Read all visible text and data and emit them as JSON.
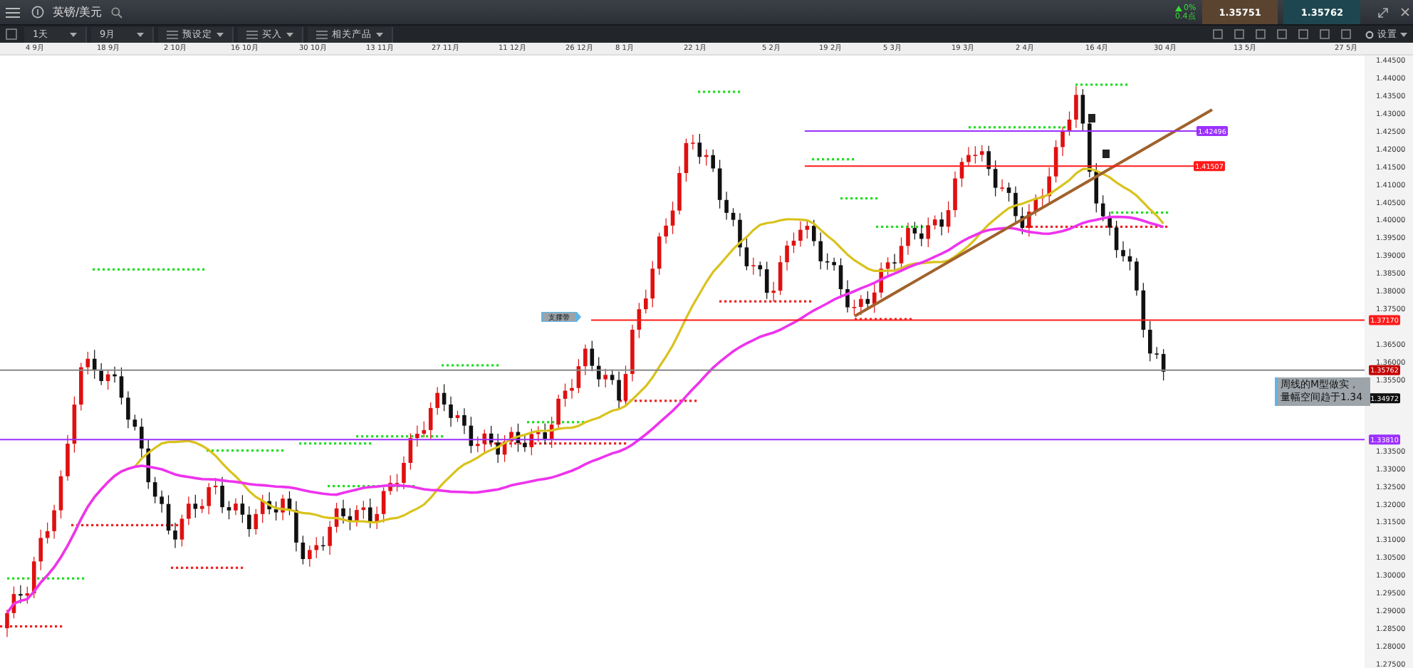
{
  "header": {
    "instrument": "英镑/美元",
    "change_pct": "0%",
    "change_points": "0.4点",
    "sell_price": "1.35751",
    "buy_price": "1.35762"
  },
  "toolbar": {
    "dropdowns": [
      {
        "label": "1天",
        "kind": "select"
      },
      {
        "label": "9月",
        "kind": "select"
      },
      {
        "label": "预设定",
        "kind": "menu"
      },
      {
        "label": "买入",
        "kind": "menu"
      },
      {
        "label": "相关产品",
        "kind": "menu"
      }
    ],
    "settings_label": "设置"
  },
  "date_axis": [
    "4 9月",
    "18 9月",
    "2 10月",
    "16 10月",
    "30 10月",
    "13 11月",
    "27 11月",
    "11 12月",
    "26 12月",
    "8 1月",
    "22 1月",
    "5 2月",
    "19 2月",
    "5 3月",
    "19 3月",
    "2 4月",
    "16 4月",
    "30 4月",
    "13 5月",
    "27 5月"
  ],
  "price_axis": [
    "1.44500",
    "1.44000",
    "1.43500",
    "1.43000",
    "1.42500",
    "1.42000",
    "1.41500",
    "1.41000",
    "1.40500",
    "1.40000",
    "1.39500",
    "1.39000",
    "1.38500",
    "1.38000",
    "1.37500",
    "1.36500",
    "1.36000",
    "1.35500",
    "1.33500",
    "1.33000",
    "1.32500",
    "1.32000",
    "1.31500",
    "1.31000",
    "1.30500",
    "1.30000",
    "1.29500",
    "1.29000",
    "1.28500",
    "1.28000",
    "1.27500"
  ],
  "levels": [
    {
      "label": "1.42496",
      "color": "#9b30ff"
    },
    {
      "label": "1.41507",
      "color": "#ff1a1a"
    },
    {
      "label": "1.37170",
      "color": "#ff1a1a"
    },
    {
      "label": "1.35762",
      "color": "#c40000"
    },
    {
      "label": "1.34972",
      "color": "#111111"
    },
    {
      "label": "1.33810",
      "color": "#9b30ff"
    }
  ],
  "callout": {
    "label": "支撑带"
  },
  "note": {
    "lines": [
      "周线的M型做实，",
      "量幅空间趋于1.34"
    ]
  }
}
